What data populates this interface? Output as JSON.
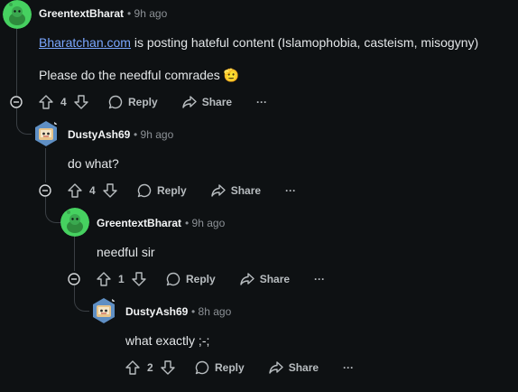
{
  "comments": [
    {
      "username": "GreentextBharat",
      "time": "9h ago",
      "avatar": "green-snoo-avatar",
      "lines": [
        {
          "link": "Bharatchan.com",
          "text": " is posting hateful content (Islamophobia, casteism, misogyny)"
        },
        {
          "text": "Please do the needful comrades",
          "emoji": "🫡"
        }
      ],
      "votes": "4",
      "reply_label": "Reply",
      "share_label": "Share",
      "more_label": "···"
    },
    {
      "username": "DustyAsh69",
      "time": "9h ago",
      "avatar": "robot-tv-avatar",
      "lines": [
        {
          "text": "do what?"
        }
      ],
      "votes": "4",
      "reply_label": "Reply",
      "share_label": "Share",
      "more_label": "···"
    },
    {
      "username": "GreentextBharat",
      "time": "9h ago",
      "avatar": "green-snoo-avatar",
      "lines": [
        {
          "text": "needful sir"
        }
      ],
      "votes": "1",
      "reply_label": "Reply",
      "share_label": "Share",
      "more_label": "···"
    },
    {
      "username": "DustyAsh69",
      "time": "8h ago",
      "avatar": "robot-tv-avatar",
      "lines": [
        {
          "text": "what exactly ;-;"
        }
      ],
      "votes": "2",
      "reply_label": "Reply",
      "share_label": "Share",
      "more_label": "···"
    }
  ],
  "separator": "•",
  "colors": {
    "background": "#0e1113",
    "link": "#7aa7ff",
    "thread_line": "#3a3f44",
    "snoo_green": "#46d160"
  }
}
